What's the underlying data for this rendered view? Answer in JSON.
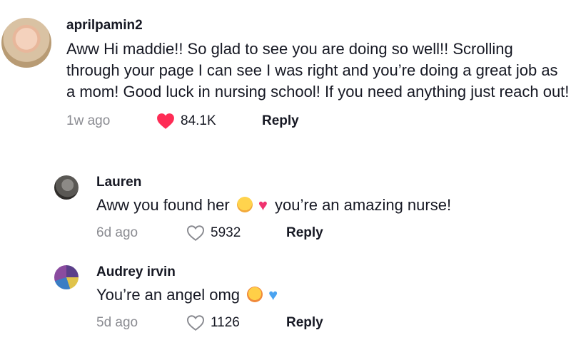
{
  "comments": {
    "main": {
      "username": "aprilpamin2",
      "text": "Aww Hi maddie!! So glad to see you are doing so well!! Scrolling through your page I can see I was right and you’re doing a great job as a mom! Good luck in nursing school! If you need anything just reach out!",
      "time": "1w ago",
      "likes": "84.1K",
      "liked": true,
      "reply_label": "Reply"
    },
    "reply1": {
      "username": "Lauren",
      "text_before": "Aww you found her",
      "emoji_1": "weary-face-emoji",
      "emoji_2": "pink-heart-emoji",
      "text_after": "you’re an amazing nurse!",
      "time": "6d ago",
      "likes": "5932",
      "liked": false,
      "reply_label": "Reply"
    },
    "reply2": {
      "username": "Audrey irvin",
      "text_before": "You’re an angel omg",
      "emoji_1": "crying-face-emoji",
      "emoji_2": "blue-heart-emoji",
      "time": "5d ago",
      "likes": "1126",
      "liked": false,
      "reply_label": "Reply"
    }
  },
  "colors": {
    "liked_heart": "#fe2c55",
    "muted_text": "#8a8b91",
    "primary_text": "#161823"
  },
  "icons": {
    "liked": "heart-filled-icon",
    "unliked": "heart-outline-icon"
  }
}
